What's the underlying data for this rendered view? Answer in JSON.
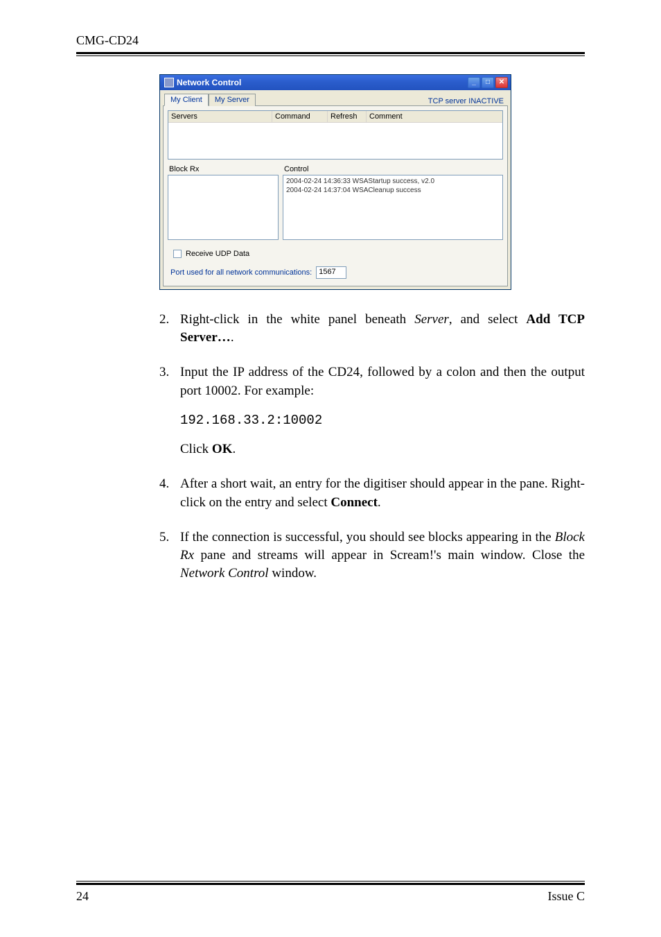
{
  "header": {
    "title": "CMG-CD24"
  },
  "screenshot": {
    "window_title": "Network Control",
    "tabs": [
      "My Client",
      "My Server"
    ],
    "status_label": "TCP server INACTIVE",
    "upper_headers": [
      "Servers",
      "Command",
      "Refresh",
      "Comment"
    ],
    "lower_left_label": "Block Rx",
    "lower_right_label": "Control",
    "control_log_1": "2004-02-24 14:36:33  WSAStartup success, v2.0",
    "control_log_2": "2004-02-24 14:37:04  WSACleanup success",
    "checkbox_label": "Receive UDP Data",
    "port_label": "Port used for all network communications:",
    "port_value": "1567",
    "win_min": "_",
    "win_max": "□",
    "win_close": "✕"
  },
  "steps": {
    "s2": {
      "num": "2.",
      "text_a": "Right-click in the white panel beneath ",
      "i1": "Server",
      "text_b": ", and select ",
      "b1": "Add TCP Server…",
      "text_c": "."
    },
    "s3": {
      "num": "3.",
      "text_a": "Input the IP address of the CD24, followed by a colon and then the output port 10002.  For example:",
      "code": "192.168.33.2:10002",
      "text_b": "Click ",
      "b1": "OK",
      "text_c": "."
    },
    "s4": {
      "num": "4.",
      "text_a": "After a short wait, an entry for the digitiser should appear in the pane.  Right-click on the entry and select ",
      "b1": "Connect",
      "text_b": "."
    },
    "s5": {
      "num": "5.",
      "text_a": "If the connection is successful, you should see blocks appearing in the ",
      "i1": "Block Rx",
      "text_b": " pane and streams will appear in Scream!'s main window.  Close the ",
      "i2": "Network Control",
      "text_c": " window."
    }
  },
  "footer": {
    "page": "24",
    "issue": "Issue C"
  }
}
